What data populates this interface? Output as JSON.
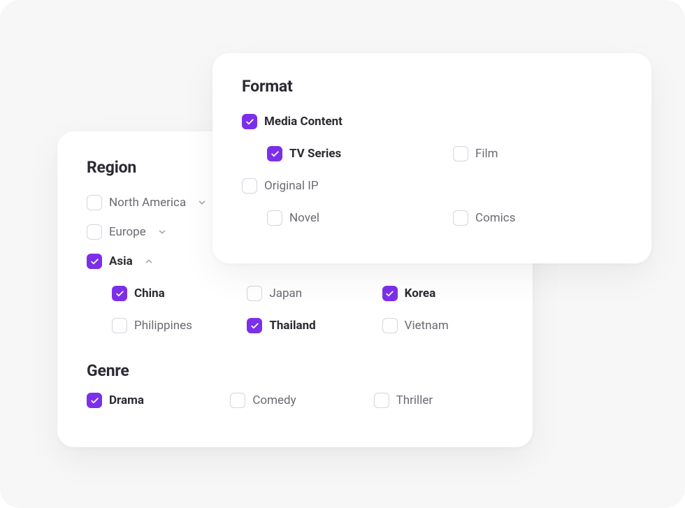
{
  "format_card": {
    "title": "Format",
    "media_content": {
      "label": "Media Content",
      "checked": true
    },
    "tv_series": {
      "label": "TV Series",
      "checked": true
    },
    "film": {
      "label": "Film",
      "checked": false
    },
    "original_ip": {
      "label": "Original IP",
      "checked": false
    },
    "novel": {
      "label": "Novel",
      "checked": false
    },
    "comics": {
      "label": "Comics",
      "checked": false
    }
  },
  "region_card": {
    "region_title": "Region",
    "north_america": {
      "label": "North America",
      "checked": false,
      "expanded": false
    },
    "europe": {
      "label": "Europe",
      "checked": false,
      "expanded": false
    },
    "asia": {
      "label": "Asia",
      "checked": true,
      "expanded": true
    },
    "china": {
      "label": "China",
      "checked": true
    },
    "japan": {
      "label": "Japan",
      "checked": false
    },
    "korea": {
      "label": "Korea",
      "checked": true
    },
    "philippines": {
      "label": "Philippines",
      "checked": false
    },
    "thailand": {
      "label": "Thailand",
      "checked": true
    },
    "vietnam": {
      "label": "Vietnam",
      "checked": false
    },
    "genre_title": "Genre",
    "drama": {
      "label": "Drama",
      "checked": true
    },
    "comedy": {
      "label": "Comedy",
      "checked": false
    },
    "thriller": {
      "label": "Thriller",
      "checked": false
    }
  }
}
